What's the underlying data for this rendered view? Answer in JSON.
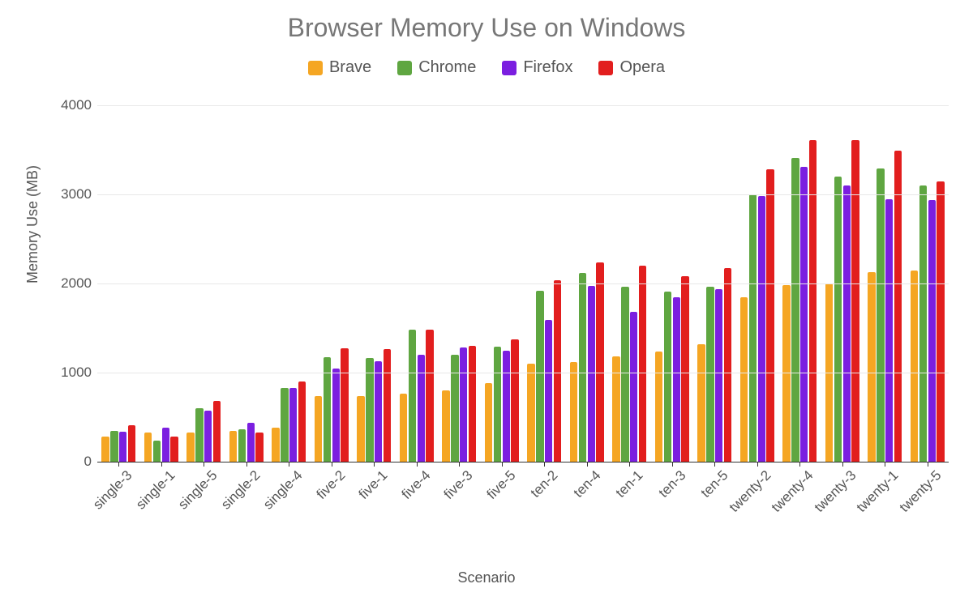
{
  "chart_data": {
    "type": "bar",
    "title": "Browser Memory Use on Windows",
    "xlabel": "Scenario",
    "ylabel": "Memory Use (MB)",
    "ylim": [
      0,
      4000
    ],
    "yticks": [
      0,
      1000,
      2000,
      3000,
      4000
    ],
    "categories": [
      "single-3",
      "single-1",
      "single-5",
      "single-2",
      "single-4",
      "five-2",
      "five-1",
      "five-4",
      "five-3",
      "five-5",
      "ten-2",
      "ten-4",
      "ten-1",
      "ten-3",
      "ten-5",
      "twenty-2",
      "twenty-4",
      "twenty-3",
      "twenty-1",
      "twenty-5"
    ],
    "series": [
      {
        "name": "Brave",
        "color": "#f5a623",
        "values": [
          280,
          330,
          330,
          350,
          380,
          740,
          740,
          760,
          800,
          880,
          1100,
          1120,
          1180,
          1240,
          1320,
          1850,
          1980,
          2000,
          2130,
          2150
        ]
      },
      {
        "name": "Chrome",
        "color": "#5fa641",
        "values": [
          350,
          240,
          600,
          360,
          830,
          1170,
          1160,
          1480,
          1200,
          1290,
          1920,
          2120,
          1960,
          1910,
          1960,
          3000,
          3410,
          3200,
          3290,
          3100
        ]
      },
      {
        "name": "Firefox",
        "color": "#7b1fe0",
        "values": [
          340,
          380,
          570,
          440,
          830,
          1050,
          1130,
          1200,
          1280,
          1250,
          1590,
          1970,
          1680,
          1850,
          1940,
          2980,
          3310,
          3100,
          2950,
          2940
        ]
      },
      {
        "name": "Opera",
        "color": "#e21e1e",
        "values": [
          410,
          280,
          680,
          330,
          900,
          1270,
          1260,
          1480,
          1300,
          1370,
          2040,
          2240,
          2200,
          2080,
          2170,
          3280,
          3610,
          3610,
          3490,
          3150
        ]
      }
    ]
  }
}
